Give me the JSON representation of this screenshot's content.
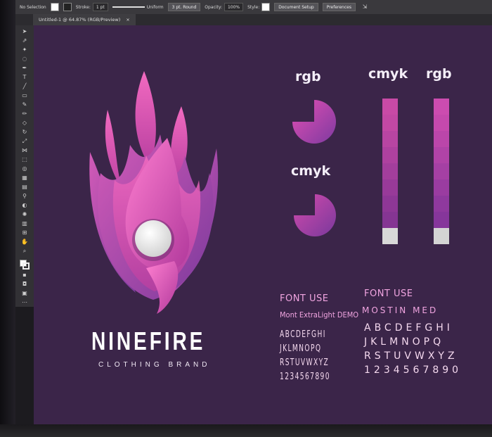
{
  "control_bar": {
    "selection": "No Selection",
    "stroke_label": "Stroke:",
    "stroke_weight": "1 pt",
    "stroke_profile": "Uniform",
    "brush": "3 pt. Round",
    "opacity_label": "Opacity:",
    "opacity_value": "100%",
    "style_label": "Style:",
    "document_setup": "Document Setup",
    "preferences": "Preferences"
  },
  "document_tab": {
    "title": "Untitled-1 @ 64.87% (RGB/Preview)",
    "close": "×"
  },
  "logo": {
    "brand_name": "NINEFIRE",
    "brand_subtitle": "CLOTHING BRAND"
  },
  "swatches": {
    "rgb_label_top": "rgb",
    "cmyk_label_mid": "cmyk",
    "cmyk_label_col": "cmyk",
    "rgb_label_col": "rgb",
    "cmyk_column": [
      "#c84aa6",
      "#c248a4",
      "#b845a2",
      "#ae419f",
      "#a33e9c",
      "#983a99",
      "#8e3796",
      "#853593",
      "#d8d8d8"
    ],
    "rgb_column": [
      "#cc4cb0",
      "#c549ad",
      "#bb46aa",
      "#b043a7",
      "#a540a4",
      "#9a3ca1",
      "#8f399e",
      "#86369b",
      "#d4d4d4"
    ]
  },
  "fonts": {
    "left_heading": "FONT USE",
    "left_font_name": "Mont ExtraLight DEMO",
    "left_glyphs": [
      "ABCDEFGHI",
      "JKLMNOPQ",
      "RSTUVWXYZ",
      "1234567890"
    ],
    "right_heading": "FONT USE",
    "right_font_name": "MOSTIN MED",
    "right_glyphs": [
      "ABCDEFGHI",
      "JKLMNOPQ",
      "RSTUVWXYZ",
      "1234567890"
    ]
  },
  "colors": {
    "canvas": "#3b2549",
    "pink": "#e64fa8",
    "purple": "#7a3a9c"
  }
}
